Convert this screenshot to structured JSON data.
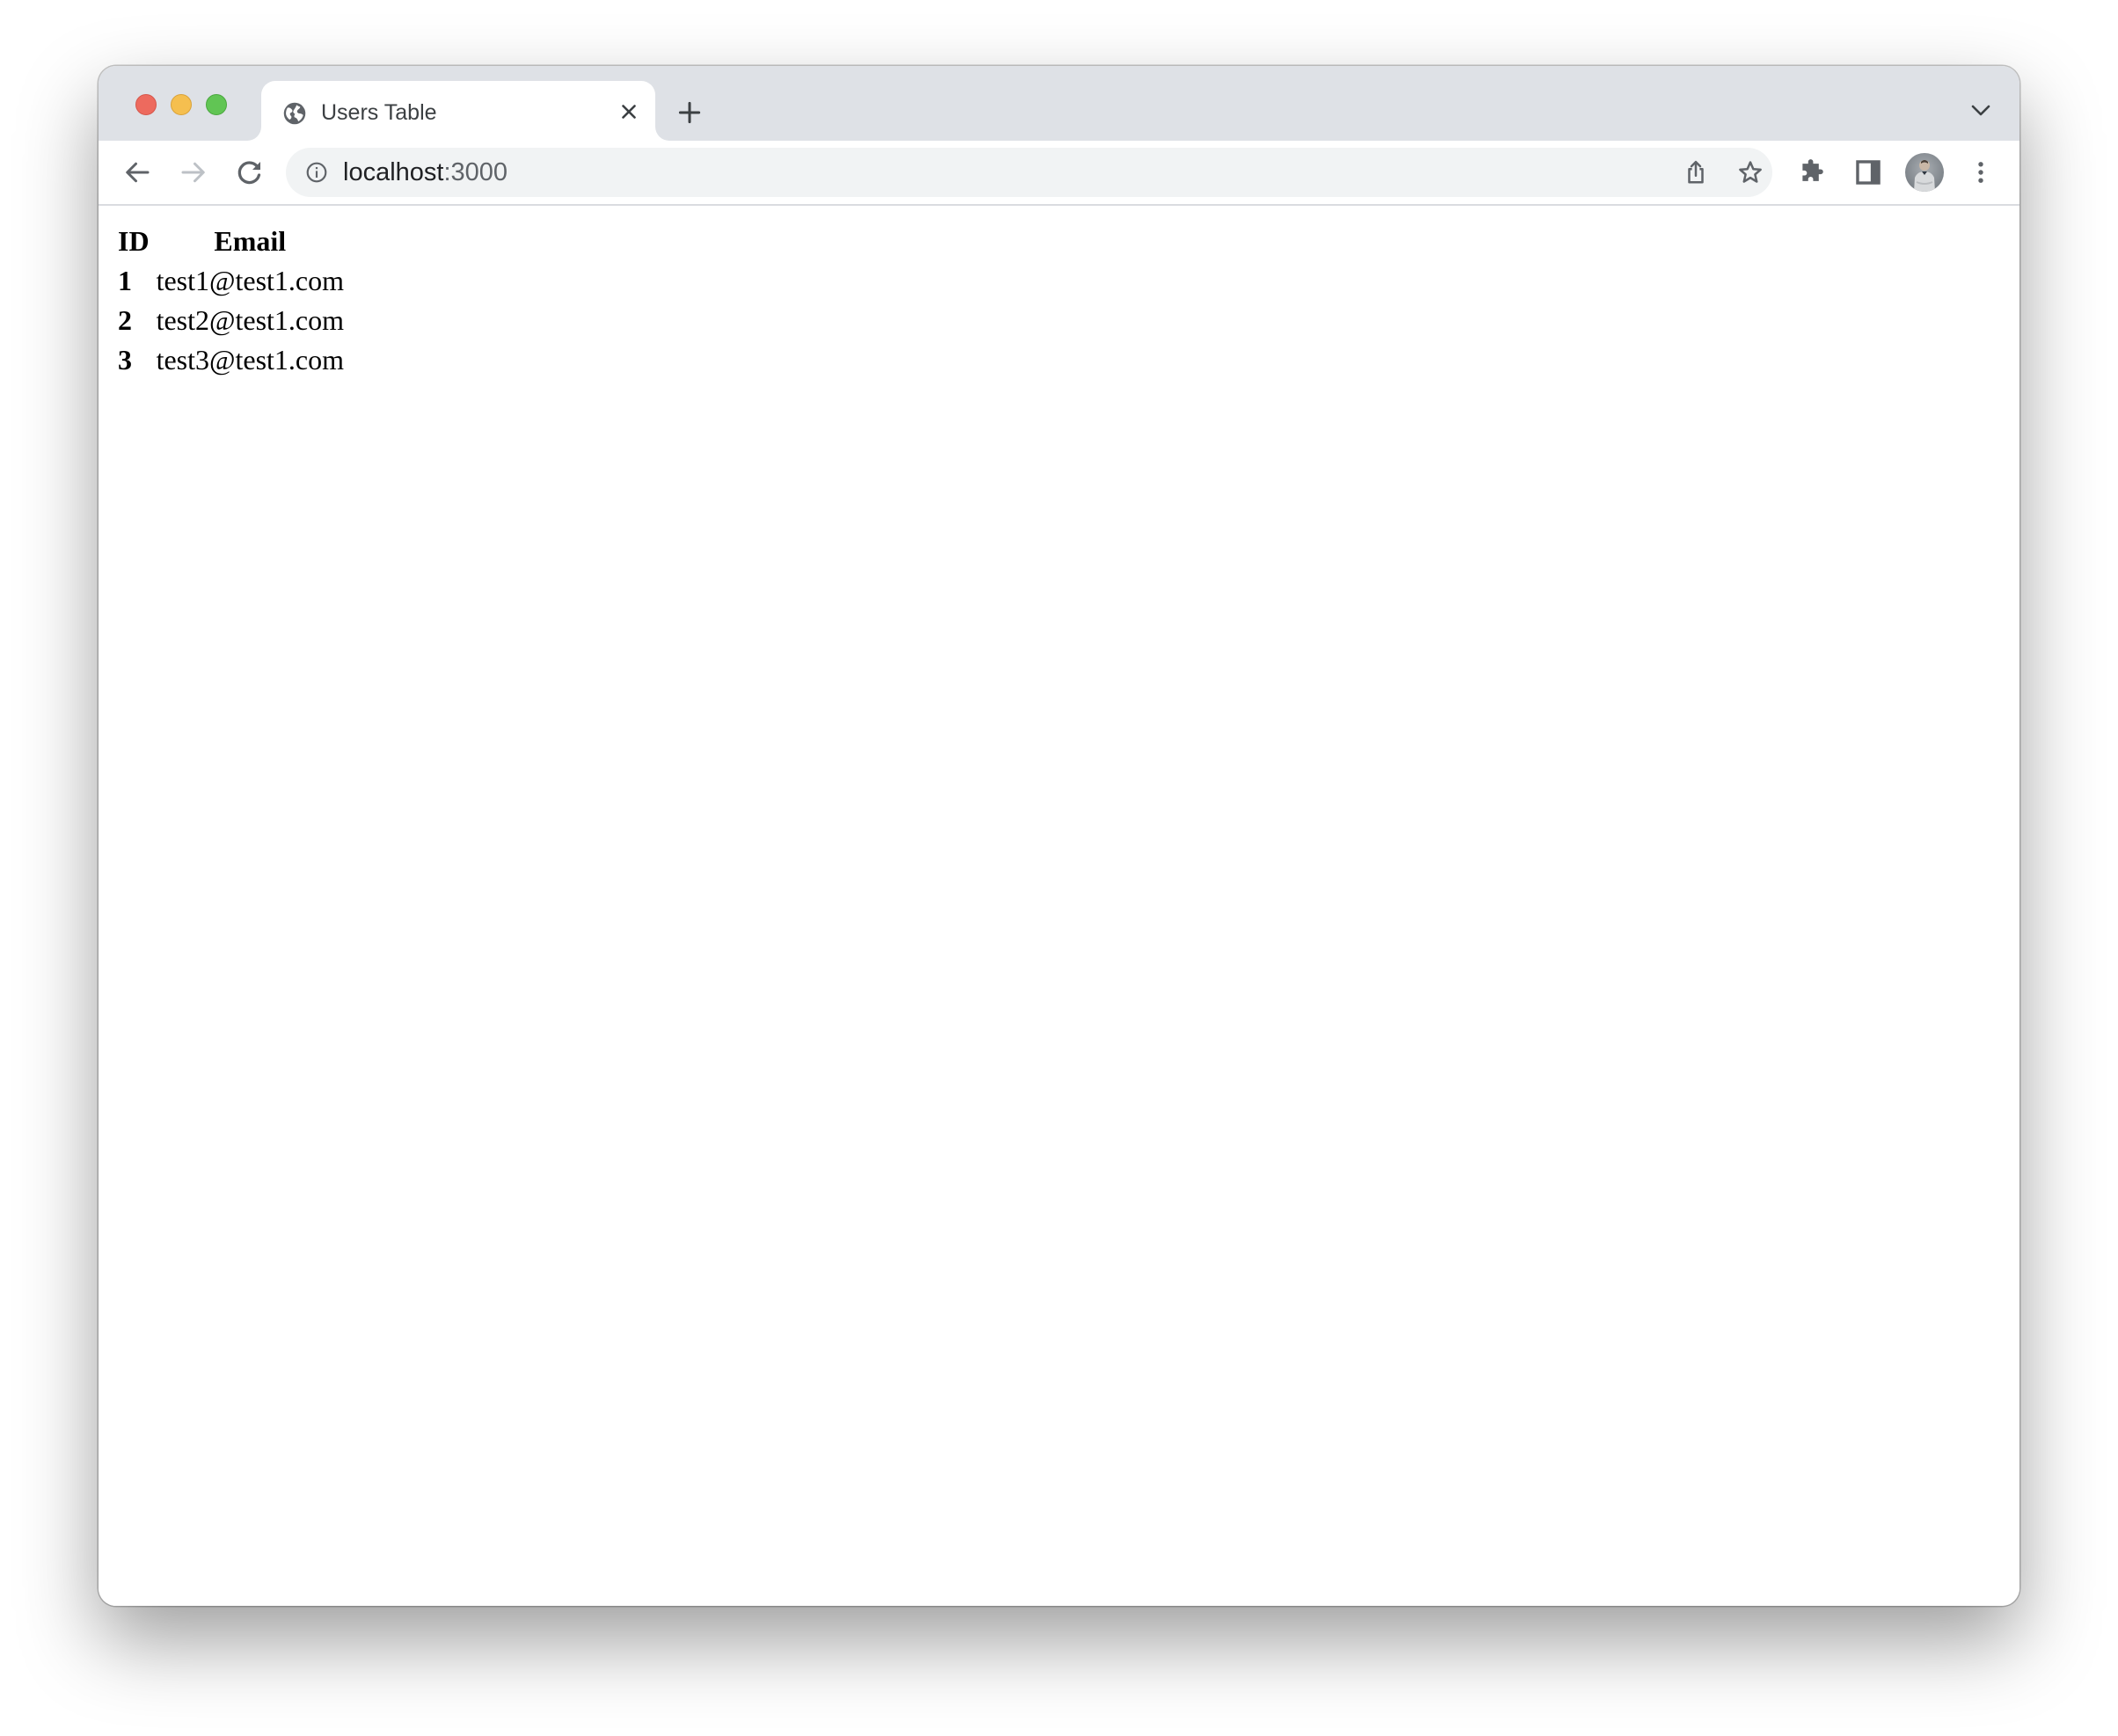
{
  "window": {
    "traffic_lights": [
      "close",
      "minimize",
      "maximize"
    ]
  },
  "tabs": [
    {
      "title": "Users Table",
      "favicon": "globe-icon",
      "active": true
    }
  ],
  "tabstrip": {
    "new_tab_icon": "plus-icon",
    "tab_search_icon": "chevron-down-icon"
  },
  "toolbar": {
    "back_icon": "arrow-left-icon",
    "forward_icon": "arrow-right-icon",
    "reload_icon": "reload-icon",
    "address": {
      "host": "localhost",
      "port": ":3000",
      "site_info_icon": "info-icon"
    },
    "share_icon": "share-icon",
    "bookmark_icon": "star-icon",
    "extensions_icon": "puzzle-icon",
    "side_panel_icon": "side-panel-icon",
    "profile_icon": "avatar",
    "menu_icon": "kebab-menu-icon"
  },
  "page": {
    "table": {
      "headers": [
        "ID",
        "Email"
      ],
      "rows": [
        {
          "id": "1",
          "email": "test1@test1.com"
        },
        {
          "id": "2",
          "email": "test2@test1.com"
        },
        {
          "id": "3",
          "email": "test3@test1.com"
        }
      ]
    }
  },
  "colors": {
    "tabstrip_bg": "#dee1e6",
    "omnibox_bg": "#f1f3f4",
    "icon": "#5f6368",
    "icon_disabled": "#bdc1c6",
    "close": "#ed6a5e",
    "minimize": "#f5bf4f",
    "maximize": "#61c554"
  }
}
